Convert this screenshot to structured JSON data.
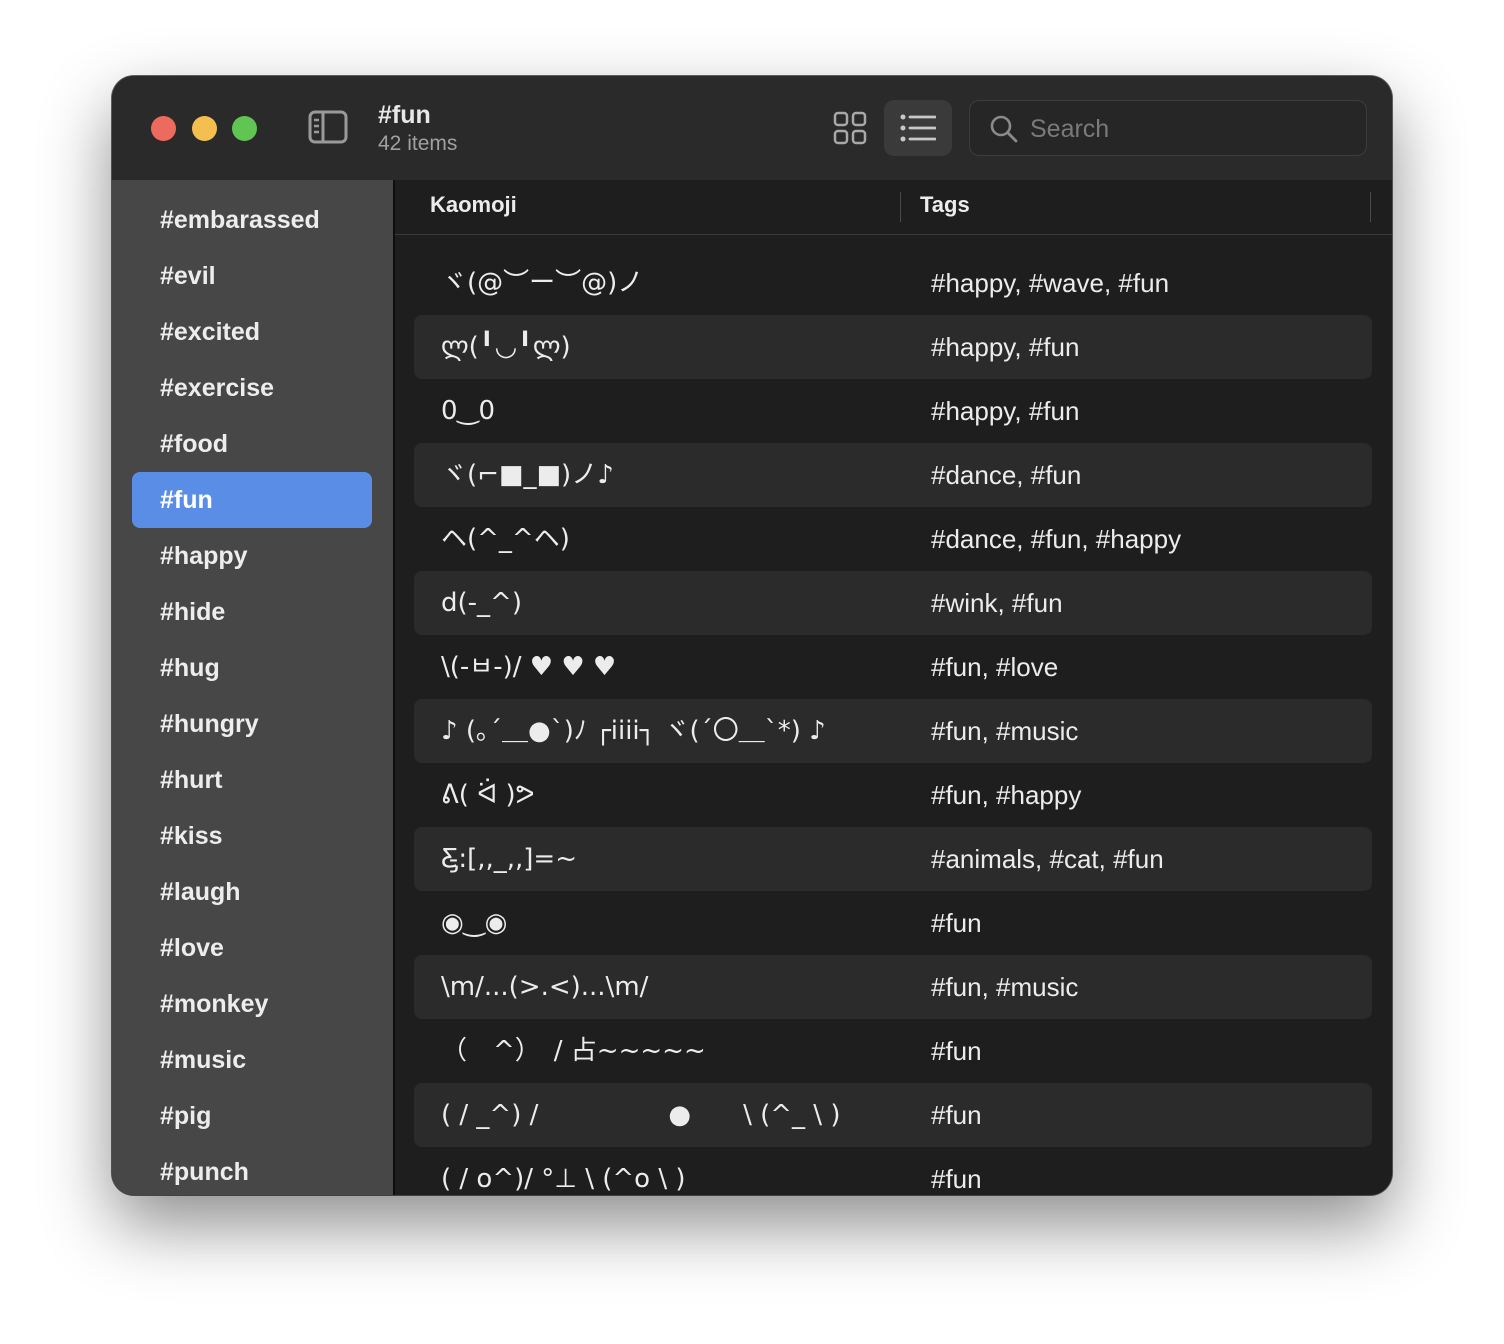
{
  "window": {
    "title": "#fun",
    "subtitle": "42 items"
  },
  "toolbar": {
    "sidebar_toggle_icon": "sidebar-icon",
    "grid_view_icon": "grid-icon",
    "list_view_icon": "list-icon",
    "search_placeholder": "Search",
    "search_value": ""
  },
  "sidebar": {
    "items": [
      {
        "label": "#embarassed"
      },
      {
        "label": "#evil"
      },
      {
        "label": "#excited"
      },
      {
        "label": "#exercise"
      },
      {
        "label": "#food"
      },
      {
        "label": "#fun",
        "selected": true
      },
      {
        "label": "#happy"
      },
      {
        "label": "#hide"
      },
      {
        "label": "#hug"
      },
      {
        "label": "#hungry"
      },
      {
        "label": "#hurt"
      },
      {
        "label": "#kiss"
      },
      {
        "label": "#laugh"
      },
      {
        "label": "#love"
      },
      {
        "label": "#monkey"
      },
      {
        "label": "#music"
      },
      {
        "label": "#pig"
      },
      {
        "label": "#punch"
      }
    ]
  },
  "table": {
    "columns": [
      "Kaomoji",
      "Tags"
    ],
    "rows": [
      {
        "kaomoji": "ヾ(@︶ー︶@)ノ",
        "tags": "#happy, #wave, #fun"
      },
      {
        "kaomoji": "ლ(╹◡╹ლ)",
        "tags": "#happy, #fun"
      },
      {
        "kaomoji": "0‿0",
        "tags": "#happy, #fun"
      },
      {
        "kaomoji": "ヾ(⌐■_■)ノ♪",
        "tags": "#dance, #fun"
      },
      {
        "kaomoji": "ヘ(^_^ヘ)",
        "tags": "#dance, #fun, #happy"
      },
      {
        "kaomoji": "d(-_^)",
        "tags": "#wink, #fun"
      },
      {
        "kaomoji": "\\(-ㅂ-)/ ♥ ♥ ♥",
        "tags": "#fun, #love"
      },
      {
        "kaomoji": "♪ (｡´＿●`)ﾉ ┌iiii┐ ヾ(´〇＿`*) ♪",
        "tags": "#fun, #music"
      },
      {
        "kaomoji": "ᕕ( ᐛ )ᕗ",
        "tags": "#fun, #happy"
      },
      {
        "kaomoji": "Ƹ̵̡:[,,_,,]=~",
        "tags": "#animals, #cat, #fun"
      },
      {
        "kaomoji": "◉‿◉",
        "tags": "#fun"
      },
      {
        "kaomoji": "\\m/...(>.<)...\\m/",
        "tags": "#fun, #music"
      },
      {
        "kaomoji": "（　^）　/ 占~~~~~",
        "tags": "#fun"
      },
      {
        "kaomoji": "( / _^) /　　　　　●　　\\ (^_ \\ )",
        "tags": "#fun"
      },
      {
        "kaomoji": "( / o^)/ °⊥ \\ (^o \\ )",
        "tags": "#fun"
      }
    ]
  },
  "colors": {
    "accent": "#5a8ee6",
    "close": "#ed6a5e",
    "minimize": "#f5bf4f",
    "zoom": "#61c554"
  }
}
